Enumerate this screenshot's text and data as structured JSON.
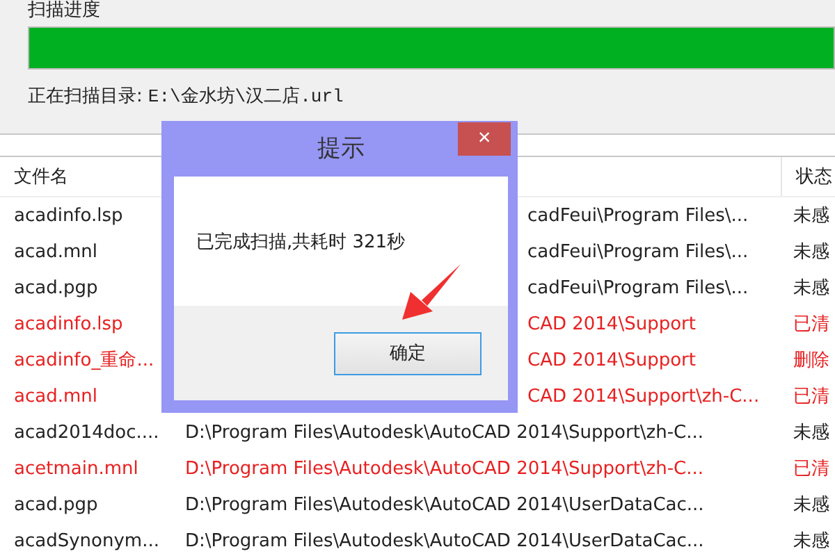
{
  "scan_panel": {
    "title": "扫描进度",
    "progress": {
      "level": 1
    },
    "current_dir_label": "正在扫描目录:",
    "current_dir": "E:\\金水坊\\汉二店.url"
  },
  "table": {
    "columns": [
      "文件名",
      "状态"
    ],
    "rows": [
      {
        "name": "acadinfo.lsp",
        "path": "cadFeui\\Program Files\\...",
        "status": "未感",
        "flagged": false,
        "covered": true
      },
      {
        "name": "acad.mnl",
        "path": "cadFeui\\Program Files\\...",
        "status": "未感",
        "flagged": false,
        "covered": true
      },
      {
        "name": "acad.pgp",
        "path": "cadFeui\\Program Files\\...",
        "status": "未感",
        "flagged": false,
        "covered": true
      },
      {
        "name": "acadinfo.lsp",
        "path": "CAD 2014\\Support",
        "status": "已清",
        "flagged": true,
        "covered": true
      },
      {
        "name": "acadinfo_重命...",
        "path": "CAD 2014\\Support",
        "status": "删除",
        "flagged": true,
        "covered": true
      },
      {
        "name": "acad.mnl",
        "path": "CAD 2014\\Support\\zh-C...",
        "status": "已清",
        "flagged": true,
        "covered": true
      },
      {
        "name": "acad2014doc....",
        "path": "D:\\Program Files\\Autodesk\\AutoCAD 2014\\Support\\zh-C...",
        "status": "未感",
        "flagged": false,
        "covered": false
      },
      {
        "name": "acetmain.mnl",
        "path": "D:\\Program Files\\Autodesk\\AutoCAD 2014\\Support\\zh-C...",
        "status": "已清",
        "flagged": true,
        "covered": false
      },
      {
        "name": "acad.pgp",
        "path": "D:\\Program Files\\Autodesk\\AutoCAD 2014\\UserDataCac...",
        "status": "未感",
        "flagged": false,
        "covered": false
      },
      {
        "name": "acadSynonym...",
        "path": "D:\\Program Files\\Autodesk\\AutoCAD 2014\\UserDataCac...",
        "status": "未感",
        "flagged": false,
        "covered": false
      }
    ]
  },
  "dialog": {
    "title": "提示",
    "close": "×",
    "message": "已完成扫描,共耗时 321秒",
    "button": "确定"
  }
}
